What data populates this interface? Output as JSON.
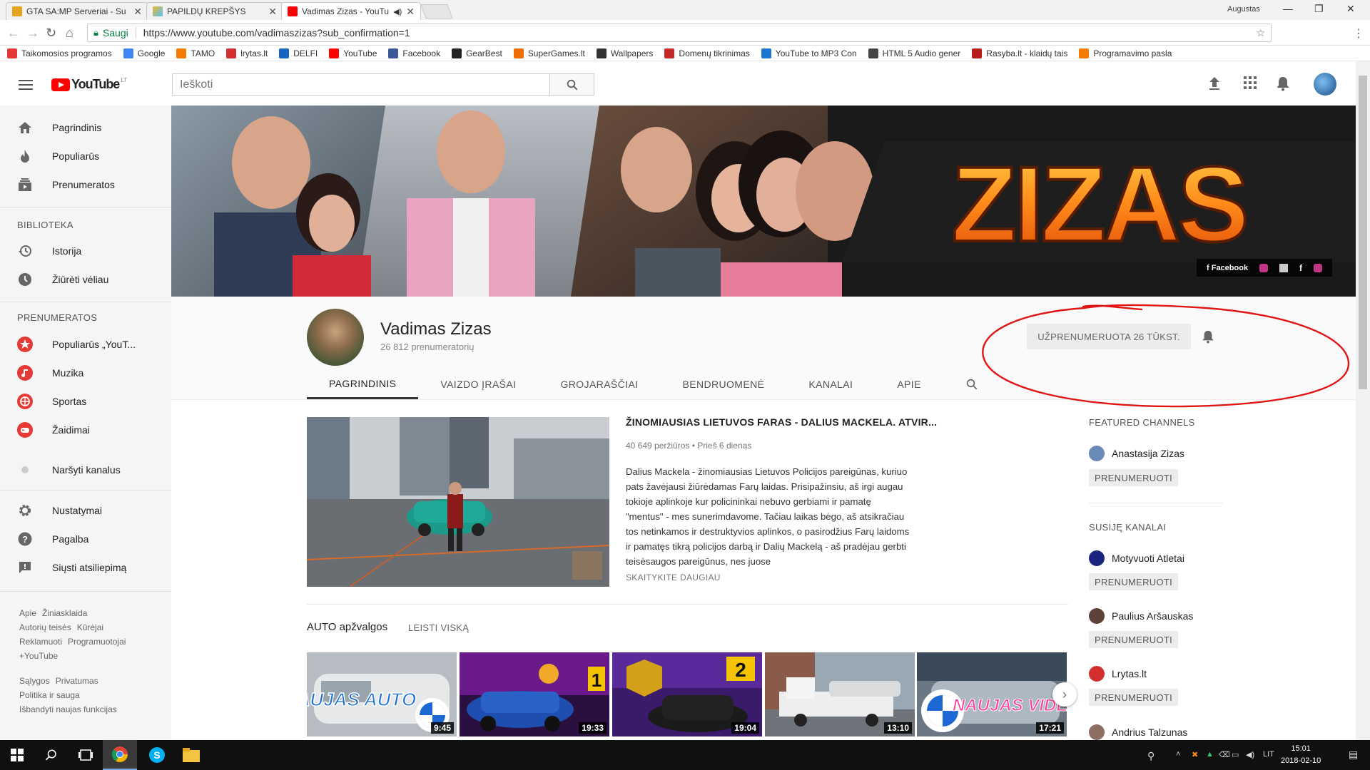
{
  "browser": {
    "tabs": [
      {
        "title": "GTA SA:MP Serveriai - Su",
        "fav": "#e8a020"
      },
      {
        "title": "PAPILDŲ KREPŠYS",
        "fav": "#f2b531"
      },
      {
        "title": "Vadimas Zizas - YouTu",
        "fav": "#ff0000"
      }
    ],
    "user": "Augustas",
    "secure_label": "Saugi",
    "url": "https://www.youtube.com/vadimaszizas?sub_confirmation=1",
    "bookmarks": [
      {
        "label": "Taikomosios programos",
        "color": "#e53935"
      },
      {
        "label": "Google",
        "color": "#4285f4"
      },
      {
        "label": "TAMO",
        "color": "#f57c00"
      },
      {
        "label": "lrytas.lt",
        "color": "#d32f2f"
      },
      {
        "label": "DELFI",
        "color": "#1565c0"
      },
      {
        "label": "YouTube",
        "color": "#ff0000"
      },
      {
        "label": "Facebook",
        "color": "#3b5998"
      },
      {
        "label": "GearBest",
        "color": "#222222"
      },
      {
        "label": "SuperGames.lt",
        "color": "#ef6c00"
      },
      {
        "label": "Wallpapers",
        "color": "#333333"
      },
      {
        "label": "Domenų tikrinimas",
        "color": "#c62828"
      },
      {
        "label": "YouTube to MP3 Con",
        "color": "#1976d2"
      },
      {
        "label": "HTML 5 Audio gener",
        "color": "#444444"
      },
      {
        "label": "Rasyba.lt - klaidų tais",
        "color": "#b71c1c"
      },
      {
        "label": "Programavimo pasla",
        "color": "#f57c00"
      }
    ]
  },
  "yt": {
    "logo_word": "YouTube",
    "logo_region": "LT",
    "search_placeholder": "Ieškoti"
  },
  "sidebar": {
    "main": [
      "Pagrindinis",
      "Populiarūs",
      "Prenumeratos"
    ],
    "library_heading": "BIBLIOTEKA",
    "library": [
      "Istorija",
      "Žiūrėti vėliau"
    ],
    "subs_heading": "PRENUMERATOS",
    "subs": [
      {
        "label": "Populiarūs „YouT...",
        "color": "#e53935"
      },
      {
        "label": "Muzika",
        "color": "#e53935"
      },
      {
        "label": "Sportas",
        "color": "#e53935"
      },
      {
        "label": "Žaidimai",
        "color": "#e53935"
      }
    ],
    "browse": "Naršyti kanalus",
    "settings": [
      "Nustatymai",
      "Pagalba",
      "Siųsti atsiliepimą"
    ],
    "footer1": [
      "Apie",
      "Žiniasklaida",
      "Autorių teisės",
      "Kūrėjai",
      "Reklamuoti",
      "Programuotojai",
      "+YouTube"
    ],
    "footer2": [
      "Sąlygos",
      "Privatumas",
      "Politika ir sauga",
      "Išbandyti naujas funkcijas"
    ]
  },
  "banner": {
    "text": "ZIZAS",
    "social": "Facebook"
  },
  "channel": {
    "name": "Vadimas Zizas",
    "subscribers": "26 812 prenumeratorių",
    "subscribed_label": "UŽPRENUMERUOTA  26 TŪKST.",
    "tabs": [
      "PAGRINDINIS",
      "VAIZDO ĮRAŠAI",
      "GROJARAŠČIAI",
      "BENDRUOMENĖ",
      "KANALAI",
      "APIE"
    ]
  },
  "featured": {
    "title": "ŽINOMIAUSIAS LIETUVOS FARAS - DALIUS MACKELA. ATVIR...",
    "meta": "40 649 peržiūros  •  Prieš 6 dienas",
    "description": "Dalius Mackela - žinomiausias Lietuvos Policijos pareigūnas, kuriuo pats žavėjausi žiūrėdamas Farų laidas. Prisipažinsiu, aš irgi augau tokioje aplinkoje kur policininkai nebuvo gerbiami ir pamatę \"mentus\" - mes sunerimdavome. Tačiau laikas bėgo, aš atsikračiau tos netinkamos ir destruktyvios aplinkos, o pasirodžius Farų laidoms ir pamatęs tikrą policijos darbą ir Dalių Mackelą - aš pradėjau gerbti teisėsaugos pareigūnus, nes juose",
    "more": "SKAITYKITE DAUGIAU"
  },
  "shelf": {
    "title": "AUTO apžvalgos",
    "play_all": "LEISTI VISKĄ",
    "videos": [
      {
        "duration": "9:45",
        "overlay": "NAUJAS AUTO"
      },
      {
        "duration": "19:33",
        "overlay": "1"
      },
      {
        "duration": "19:04",
        "overlay": "2"
      },
      {
        "duration": "13:10",
        "overlay": ""
      },
      {
        "duration": "17:21",
        "overlay": "NAUJAS VIDEO"
      }
    ]
  },
  "right": {
    "featured_heading": "FEATURED CHANNELS",
    "featured": [
      {
        "name": "Anastasija Zizas",
        "color": "#6a8bb8"
      }
    ],
    "related_heading": "SUSIJĘ KANALAI",
    "related": [
      {
        "name": "Motyvuoti Atletai",
        "color": "#1a237e"
      },
      {
        "name": "Paulius Aršauskas",
        "color": "#5d4037"
      },
      {
        "name": "Lrytas.lt",
        "color": "#d32f2f"
      },
      {
        "name": "Andrius Talzunas",
        "color": "#8d6e63"
      }
    ],
    "subscribe_label": "PRENUMERUOTI"
  },
  "taskbar": {
    "lang": "LIT",
    "time": "15:01",
    "date": "2018-02-10"
  }
}
